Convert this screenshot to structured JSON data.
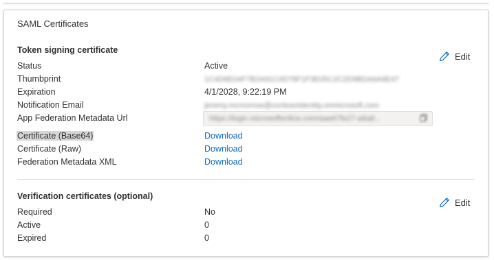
{
  "card": {
    "title": "SAML Certificates"
  },
  "token_signing": {
    "heading": "Token signing certificate",
    "edit_label": "Edit",
    "rows": [
      {
        "label": "Status",
        "value": "Active"
      },
      {
        "label": "Thumbprint",
        "value": "1C4D8E04F7B2A91C0D78F1F3E05C2C2D9BDA6A9E47"
      },
      {
        "label": "Expiration",
        "value": "4/1/2028, 9:22:19 PM"
      },
      {
        "label": "Notification Email",
        "value": "jeremy.mcmorrow@contosoidentity.onmicrosoft.com"
      },
      {
        "label": "App Federation Metadata Url",
        "value": "https://login.microsoftonline.com/aae67fe27-a6a8..."
      },
      {
        "label": "Certificate (Base64)",
        "value": "Download"
      },
      {
        "label": "Certificate (Raw)",
        "value": "Download"
      },
      {
        "label": "Federation Metadata XML",
        "value": "Download"
      }
    ]
  },
  "verification": {
    "heading": "Verification certificates (optional)",
    "edit_label": "Edit",
    "rows": [
      {
        "label": "Required",
        "value": "No"
      },
      {
        "label": "Active",
        "value": "0"
      },
      {
        "label": "Expired",
        "value": "0"
      }
    ]
  },
  "colors": {
    "link": "#0f6cbd",
    "edit_icon": "#0f6cbd",
    "text": "#323130",
    "highlight": "#d6d6d6"
  }
}
